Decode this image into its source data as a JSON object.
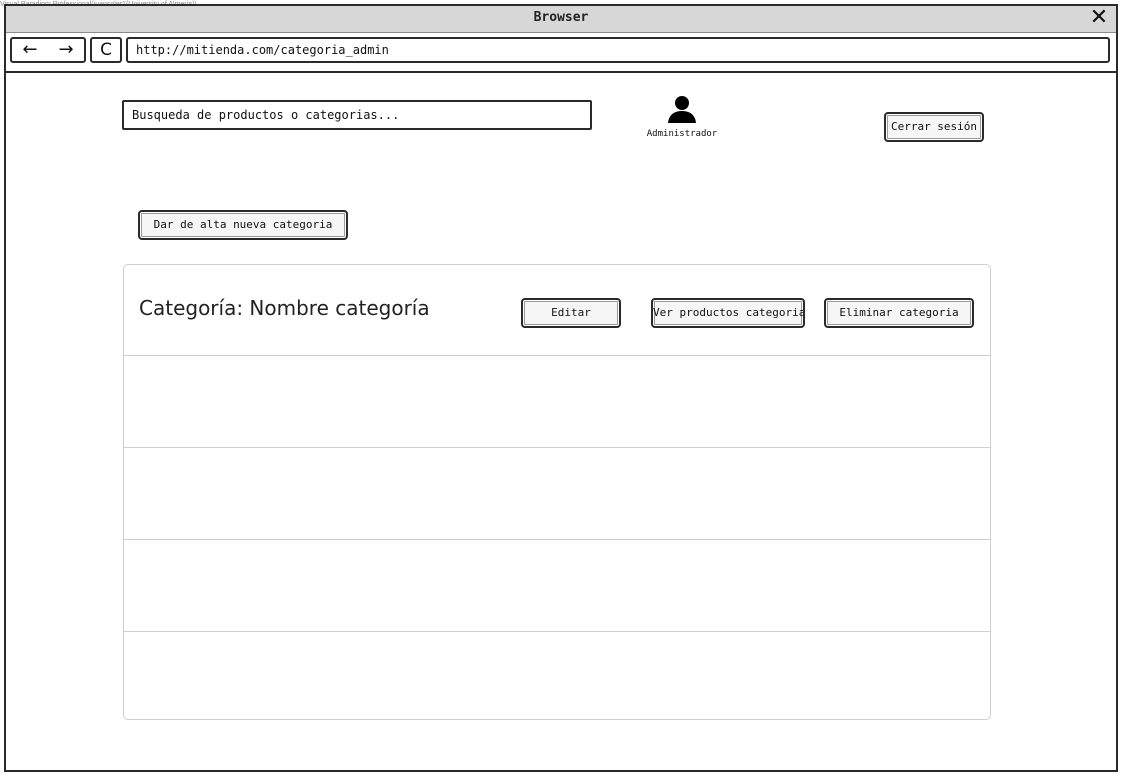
{
  "watermark": "Visual Paradigm Professional(juansoler1(University of Almeria))",
  "window": {
    "title": "Browser",
    "close_glyph": "✕"
  },
  "toolbar": {
    "back_glyph": "←",
    "forward_glyph": "→",
    "reload_glyph": "C",
    "url": "http://mitienda.com/categoria_admin"
  },
  "header": {
    "search_text": "Busqueda de productos o categorias...",
    "user_icon": "user-icon",
    "user_name": "Administrador",
    "logout_label": "Cerrar sesión"
  },
  "actions": {
    "add_category_label": "Dar de alta nueva categoria"
  },
  "category_panel": {
    "title": "Categoría: Nombre categoría",
    "edit_label": "Editar",
    "view_products_label": "Ver productos categoria",
    "delete_label": "Eliminar categoria",
    "rows": [
      "",
      "",
      "",
      ""
    ]
  }
}
